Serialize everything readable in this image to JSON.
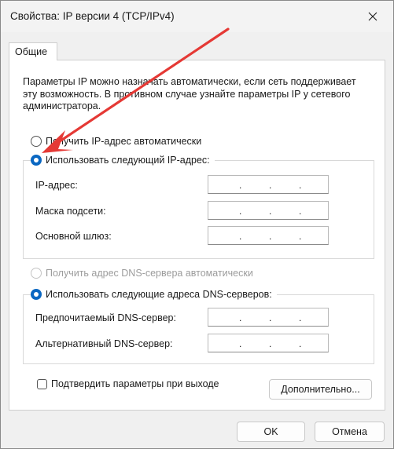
{
  "window": {
    "title": "Свойства: IP версии 4 (TCP/IPv4)"
  },
  "tabs": [
    {
      "label": "Общие"
    }
  ],
  "description": "Параметры IP можно назначать автоматически, если сеть поддерживает эту возможность. В противном случае узнайте параметры IP у сетевого администратора.",
  "ip_settings": {
    "auto_label": "Получить IP-адрес автоматически",
    "manual_label": "Использовать следующий IP-адрес:",
    "selected": "manual",
    "fields": [
      {
        "label": "IP-адрес:",
        "value": ". . ."
      },
      {
        "label": "Маска подсети:",
        "value": ". . ."
      },
      {
        "label": "Основной шлюз:",
        "value": ". . ."
      }
    ]
  },
  "dns_settings": {
    "auto_label": "Получить адрес DNS-сервера автоматически",
    "manual_label": "Использовать следующие адреса DNS-серверов:",
    "selected": "manual",
    "auto_enabled": false,
    "fields": [
      {
        "label": "Предпочитаемый DNS-сервер:",
        "value": ". . ."
      },
      {
        "label": "Альтернативный DNS-сервер:",
        "value": ". . ."
      }
    ]
  },
  "validate_on_exit": {
    "label": "Подтвердить параметры при выходе",
    "checked": false
  },
  "buttons": {
    "advanced": "Дополнительно...",
    "ok": "OK",
    "cancel": "Отмена"
  },
  "colors": {
    "accent": "#0a67c2",
    "annotation_arrow": "#e53935"
  }
}
